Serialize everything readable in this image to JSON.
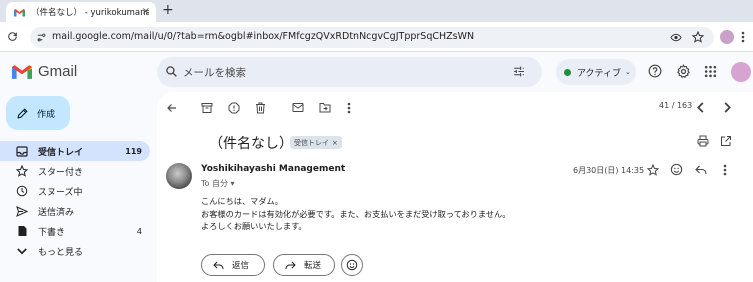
{
  "browser": {
    "tab_title": "（件名なし） - yurikokumana@",
    "tab_close": "×",
    "new_tab": "+",
    "url": "mail.google.com/mail/u/0/?tab=rm&ogbl#inbox/FMfcgzQVxRDtnNcgvCgJTpprSqCHZsWN"
  },
  "header": {
    "app_name": "Gmail",
    "search_placeholder": "メールを検索",
    "status_label": "アクティブ",
    "status_chevron": "⌄"
  },
  "sidebar": {
    "compose_label": "作成",
    "items": [
      {
        "label": "受信トレイ",
        "count": "119",
        "icon": "inbox-icon",
        "active": true
      },
      {
        "label": "スター付き",
        "count": "",
        "icon": "star-icon"
      },
      {
        "label": "スヌーズ中",
        "count": "",
        "icon": "clock-icon"
      },
      {
        "label": "送信済み",
        "count": "",
        "icon": "send-icon"
      },
      {
        "label": "下書き",
        "count": "4",
        "icon": "draft-icon"
      },
      {
        "label": "もっと見る",
        "count": "",
        "icon": "chevron-down-icon"
      }
    ]
  },
  "toolbar": {
    "pager": "41 / 163"
  },
  "message": {
    "subject": "（件名なし）",
    "label_chip": "受信トレイ",
    "label_chip_remove": "×",
    "sender": "Yoshikihayashi Management",
    "to_line": "To 自分 ▾",
    "date": "6月30日(日) 14:35",
    "body": [
      "こんにちは、マダム。",
      "お客様のカードは有効化が必要です。また、お支払いをまだ受け取っておりません。",
      "よろしくお願いいたします。"
    ],
    "reply_label": "返信",
    "forward_label": "転送"
  },
  "colors": {
    "compose_bg": "#c2e7ff",
    "active_nav_bg": "#d3e3fd",
    "status_dot": "#1e8e3e",
    "page_bg": "#f8fafd"
  }
}
